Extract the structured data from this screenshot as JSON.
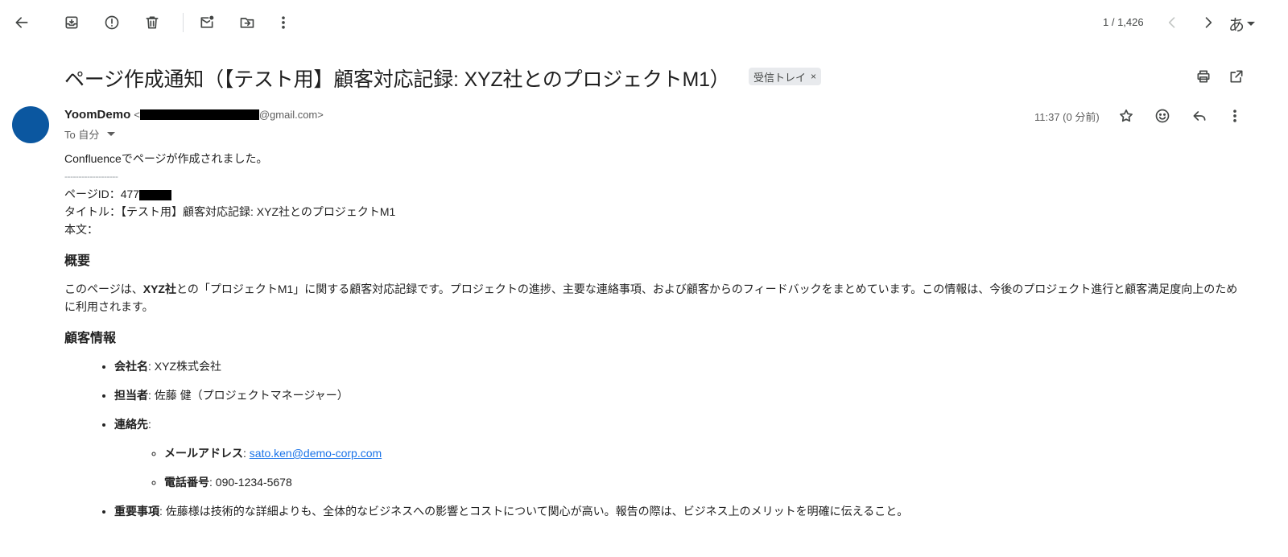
{
  "toolbar": {
    "pager": "1 / 1,426",
    "lang": "あ"
  },
  "subject": "ページ作成通知（【テスト用】顧客対応記録: XYZ社とのプロジェクトM1）",
  "label_chip": "受信トレイ",
  "label_chip_close": "×",
  "sender": {
    "name": "YoomDemo",
    "email_open": "<",
    "email_domain": "@gmail.com>",
    "to": "To 自分"
  },
  "time": "11:37 (0 分前)",
  "body": {
    "line1": "Confluenceでページが作成されました。",
    "dash": "-------------------",
    "page_id_label": "ページID：477",
    "title_line": "タイトル：【テスト用】顧客対応記録: XYZ社とのプロジェクトM1",
    "body_label": "本文：",
    "h_overview": "概要",
    "intro_pre": "このページは、",
    "intro_bold": "XYZ社",
    "intro_post": "との「プロジェクトM1」に関する顧客対応記録です。プロジェクトの進捗、主要な連絡事項、および顧客からのフィードバックをまとめています。この情報は、今後のプロジェクト進行と顧客満足度向上のために利用されます。",
    "h_customer": "顧客情報",
    "company_label": "会社名",
    "company_value": ": XYZ株式会社",
    "person_label": "担当者",
    "person_value": ": 佐藤 健（プロジェクトマネージャー）",
    "contact_label": "連絡先",
    "contact_value": ":",
    "mail_label": "メールアドレス",
    "mail_sep": ": ",
    "mail_value": "sato.ken@demo-corp.com",
    "phone_label": "電話番号",
    "phone_value": ": 090-1234-5678",
    "important_label": "重要事項",
    "important_value": ": 佐藤様は技術的な詳細よりも、全体的なビジネスへの影響とコストについて関心が高い。報告の際は、ビジネス上のメリットを明確に伝えること。"
  },
  "colors": {
    "avatar": "#0b57a0",
    "link": "#1a73e8",
    "chip_bg": "#e8eaed"
  },
  "icons": [
    "back-arrow-icon",
    "archive-icon",
    "report-spam-icon",
    "delete-icon",
    "mark-unread-icon",
    "move-to-icon",
    "more-vert-icon",
    "prev-icon",
    "next-icon",
    "print-icon",
    "open-new-window-icon",
    "star-icon",
    "emoji-icon",
    "reply-icon"
  ]
}
